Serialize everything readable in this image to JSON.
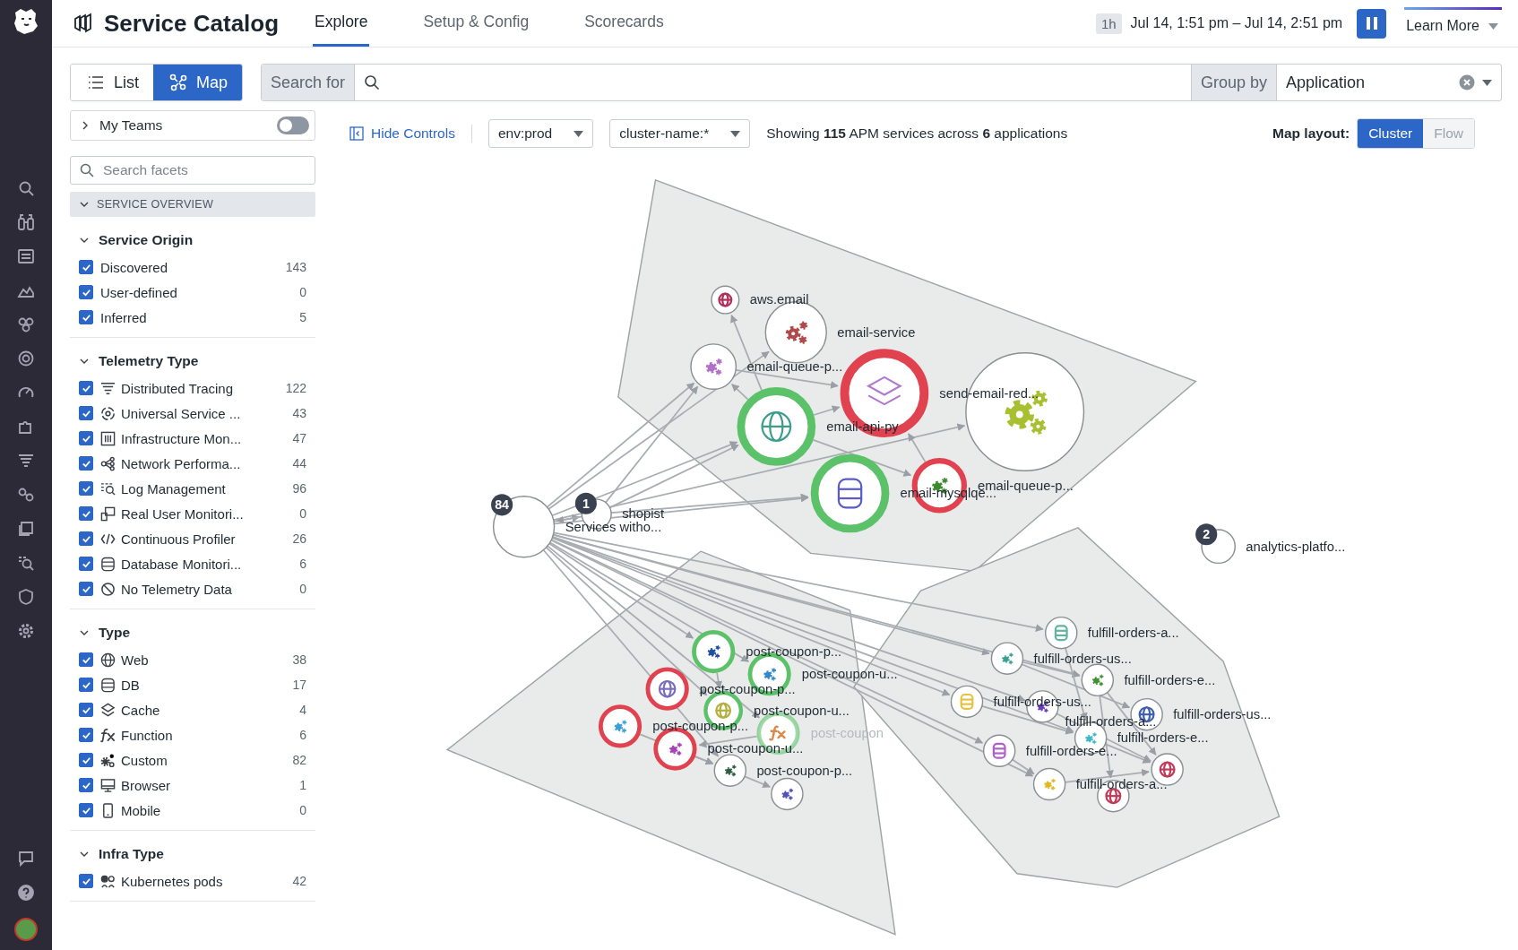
{
  "header": {
    "title": "Service Catalog",
    "tabs": [
      {
        "label": "Explore",
        "selected": true
      },
      {
        "label": "Setup & Config",
        "selected": false
      },
      {
        "label": "Scorecards",
        "selected": false
      }
    ],
    "time_preset": "1h",
    "time_range": "Jul 14, 1:51 pm – Jul 14, 2:51 pm",
    "learn_more": "Learn More"
  },
  "view_toggle": [
    {
      "label": "List",
      "kind": "list",
      "selected": false
    },
    {
      "label": "Map",
      "kind": "map",
      "selected": true
    }
  ],
  "search": {
    "label": "Search for",
    "group_by_label": "Group by",
    "group_by_value": "Application"
  },
  "facets": {
    "my_teams": {
      "label": "My Teams",
      "on": false
    },
    "search_placeholder": "Search facets",
    "section": {
      "title": "SERVICE OVERVIEW",
      "expanded": true
    },
    "groups": [
      {
        "title": "Service Origin",
        "expanded": true,
        "items": [
          {
            "label": "Discovered",
            "count": "143",
            "checked": true
          },
          {
            "label": "User-defined",
            "count": "0",
            "checked": true
          },
          {
            "label": "Inferred",
            "count": "5",
            "checked": true
          }
        ]
      },
      {
        "title": "Telemetry Type",
        "expanded": true,
        "items": [
          {
            "label": "Distributed Tracing",
            "count": "122",
            "checked": true,
            "kind": "tracing"
          },
          {
            "label": "Universal Service ...",
            "count": "43",
            "checked": true,
            "kind": "usm"
          },
          {
            "label": "Infrastructure Mon...",
            "count": "47",
            "checked": true,
            "kind": "infra"
          },
          {
            "label": "Network Performa...",
            "count": "44",
            "checked": true,
            "kind": "network"
          },
          {
            "label": "Log Management",
            "count": "96",
            "checked": true,
            "kind": "logs"
          },
          {
            "label": "Real User Monitori...",
            "count": "0",
            "checked": true,
            "kind": "rum"
          },
          {
            "label": "Continuous Profiler",
            "count": "26",
            "checked": true,
            "kind": "profiler"
          },
          {
            "label": "Database Monitori...",
            "count": "6",
            "checked": true,
            "kind": "db"
          },
          {
            "label": "No Telemetry Data",
            "count": "0",
            "checked": true,
            "kind": "none"
          }
        ]
      },
      {
        "title": "Type",
        "expanded": true,
        "items": [
          {
            "label": "Web",
            "count": "38",
            "checked": true,
            "kind": "web"
          },
          {
            "label": "DB",
            "count": "17",
            "checked": true,
            "kind": "db"
          },
          {
            "label": "Cache",
            "count": "4",
            "checked": true,
            "kind": "cache"
          },
          {
            "label": "Function",
            "count": "6",
            "checked": true,
            "kind": "function"
          },
          {
            "label": "Custom",
            "count": "82",
            "checked": true,
            "kind": "custom"
          },
          {
            "label": "Browser",
            "count": "1",
            "checked": true,
            "kind": "browser"
          },
          {
            "label": "Mobile",
            "count": "0",
            "checked": true,
            "kind": "mobile"
          }
        ]
      },
      {
        "title": "Infra Type",
        "expanded": true,
        "items": [
          {
            "label": "Kubernetes pods",
            "count": "42",
            "checked": true,
            "kind": "pods"
          }
        ]
      }
    ]
  },
  "toolbar": {
    "hide_controls": "Hide Controls",
    "filters": [
      "env:prod",
      "cluster-name:*"
    ],
    "summary": "Showing **115** APM services across **6** applications",
    "layout_label": "Map layout:",
    "layouts": [
      {
        "label": "Cluster",
        "selected": true
      },
      {
        "label": "Flow",
        "selected": false
      }
    ]
  },
  "map": {
    "nodes": [
      {
        "label": "Services witho...",
        "badge": "84",
        "kind": "group",
        "healthy": false,
        "alert": false,
        "dimmed": false
      },
      {
        "label": "shopist",
        "badge": "1",
        "kind": "group",
        "healthy": false,
        "alert": false,
        "dimmed": false
      },
      {
        "label": "aws.email",
        "kind": "web",
        "color": "#b0305a",
        "healthy": false,
        "alert": false,
        "dimmed": false
      },
      {
        "label": "email-service",
        "kind": "custom",
        "color": "#b04a4a",
        "healthy": false,
        "alert": false,
        "dimmed": false
      },
      {
        "label": "email-queue-p...",
        "kind": "custom",
        "color": "#b070c8",
        "healthy": false,
        "alert": false,
        "dimmed": false
      },
      {
        "label": "email-api-py",
        "kind": "web",
        "color": "#3f9c8c",
        "healthy": true,
        "alert": false,
        "dimmed": false
      },
      {
        "label": "send-email-red...",
        "kind": "cache",
        "color": "#b07ad0",
        "healthy": false,
        "alert": true,
        "dimmed": false
      },
      {
        "label": "email-mysqlqe...",
        "kind": "db",
        "color": "#5a5ac8",
        "healthy": true,
        "alert": false,
        "dimmed": false
      },
      {
        "label": "email-queue-p...",
        "kind": "custom",
        "color": "#3d8a2e",
        "healthy": false,
        "alert": true,
        "dimmed": false
      },
      {
        "kind": "custom",
        "color": "#a8c030",
        "healthy": false,
        "alert": false,
        "dimmed": false
      },
      {
        "label": "analytics-platfo...",
        "badge": "2",
        "kind": "group",
        "healthy": false,
        "alert": false,
        "dimmed": false
      },
      {
        "label": "post-coupon-p...",
        "kind": "custom",
        "color": "#1f4fa0",
        "healthy": true,
        "alert": false,
        "dimmed": false
      },
      {
        "label": "post-coupon-u...",
        "kind": "custom",
        "color": "#3388cc",
        "healthy": true,
        "alert": false,
        "dimmed": false
      },
      {
        "label": "post-coupon-p...",
        "kind": "web",
        "color": "#7a6cc0",
        "healthy": false,
        "alert": true,
        "dimmed": false
      },
      {
        "label": "post-coupon-u...",
        "kind": "web",
        "color": "#b3b040",
        "healthy": true,
        "alert": false,
        "dimmed": false
      },
      {
        "label": "post-coupon-p...",
        "kind": "custom",
        "color": "#3aa0d8",
        "healthy": false,
        "alert": true,
        "dimmed": false
      },
      {
        "label": "post-coupon",
        "kind": "function",
        "color": "#d98a4a",
        "healthy": true,
        "alert": false,
        "dimmed": true
      },
      {
        "label": "post-coupon-u...",
        "kind": "custom",
        "color": "#a540b8",
        "healthy": false,
        "alert": true,
        "dimmed": false
      },
      {
        "label": "post-coupon-p...",
        "kind": "custom",
        "color": "#2e5e3e",
        "healthy": false,
        "alert": false,
        "dimmed": false
      },
      {
        "kind": "custom",
        "color": "#5050b8",
        "healthy": false,
        "alert": false,
        "dimmed": false
      },
      {
        "label": "fulfill-orders-a...",
        "kind": "db",
        "color": "#5fb3a0",
        "healthy": false,
        "alert": false,
        "dimmed": false
      },
      {
        "label": "fulfill-orders-us...",
        "kind": "custom",
        "color": "#3aa090",
        "healthy": false,
        "alert": false,
        "dimmed": false
      },
      {
        "label": "fulfill-orders-e...",
        "kind": "custom",
        "color": "#3d9030",
        "healthy": false,
        "alert": false,
        "dimmed": false
      },
      {
        "label": "fulfill-orders-us...",
        "kind": "db",
        "color": "#e6c340",
        "healthy": false,
        "alert": false,
        "dimmed": false
      },
      {
        "label": "fulfill-orders-a...",
        "kind": "custom",
        "color": "#6a3cc8",
        "healthy": false,
        "alert": false,
        "dimmed": false
      },
      {
        "label": "fulfill-orders-us...",
        "kind": "web",
        "color": "#3f60b0",
        "healthy": false,
        "alert": false,
        "dimmed": false
      },
      {
        "label": "fulfill-orders-e...",
        "kind": "custom",
        "color": "#40b8c8",
        "healthy": false,
        "alert": false,
        "dimmed": false
      },
      {
        "label": "fulfill-orders-e...",
        "kind": "db",
        "color": "#b060c8",
        "healthy": false,
        "alert": false,
        "dimmed": false
      },
      {
        "label": "fulfill-orders-a...",
        "kind": "custom",
        "color": "#e0b820",
        "healthy": false,
        "alert": false,
        "dimmed": false
      },
      {
        "kind": "web",
        "color": "#c03a5a",
        "healthy": false,
        "alert": false,
        "dimmed": false
      },
      {
        "kind": "web",
        "color": "#c03a5a",
        "healthy": false,
        "alert": false,
        "dimmed": false
      }
    ]
  }
}
